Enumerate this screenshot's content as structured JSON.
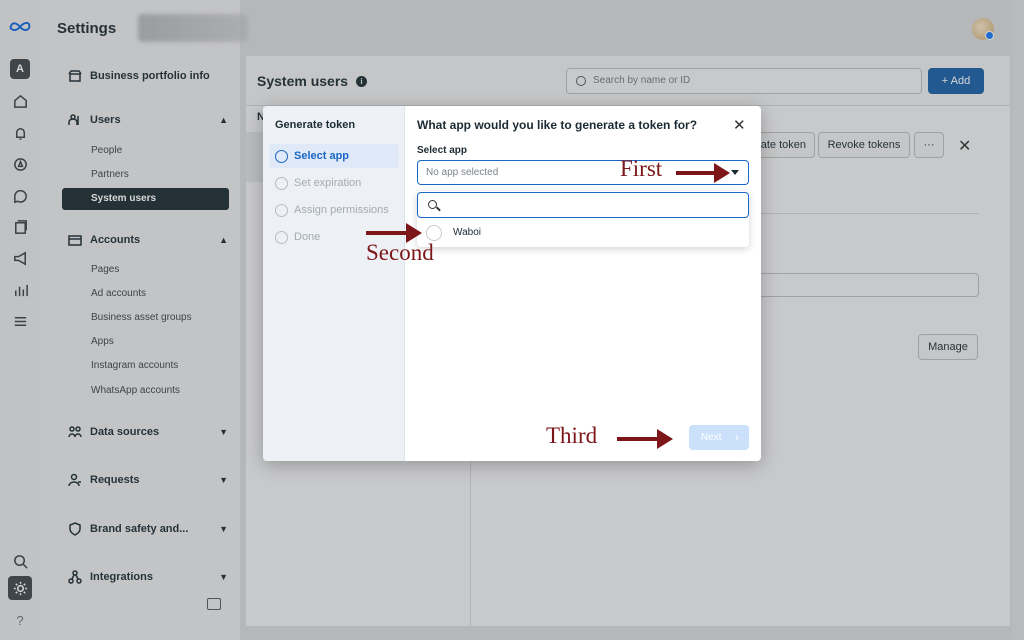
{
  "settings_title": "Settings",
  "sidebar": {
    "sections": [
      {
        "label": "Business portfolio info",
        "icon": "store-icon"
      },
      {
        "label": "Users",
        "icon": "users-icon",
        "expanded": true,
        "items": [
          "People",
          "Partners",
          "System users"
        ]
      },
      {
        "label": "Accounts",
        "icon": "folder-icon",
        "expanded": true,
        "items": [
          "Pages",
          "Ad accounts",
          "Business asset groups",
          "Apps",
          "Instagram accounts",
          "WhatsApp accounts"
        ]
      },
      {
        "label": "Data sources",
        "icon": "data-sources-icon"
      },
      {
        "label": "Requests",
        "icon": "requests-icon"
      },
      {
        "label": "Brand safety and...",
        "icon": "shield-icon"
      },
      {
        "label": "Integrations",
        "icon": "integrations-icon"
      }
    ],
    "active_item": "System users"
  },
  "rail": {
    "avatar_letter": "A",
    "help": "?"
  },
  "main": {
    "title": "System users",
    "search_placeholder": "Search by name or ID",
    "add_label": "+ Add",
    "list_header": "N",
    "gen_token_label": "ate token",
    "revoke_label": "Revoke tokens",
    "more_label": "···",
    "manage_label": "Manage"
  },
  "modal": {
    "steps_title": "Generate token",
    "steps": [
      "Select app",
      "Set expiration",
      "Assign permissions",
      "Done"
    ],
    "active_step": 0,
    "question": "What app would you like to generate a token for?",
    "select_label": "Select app",
    "select_placeholder": "No app selected",
    "options": [
      "Waboi"
    ],
    "next_label": "Next"
  },
  "annotations": {
    "first": "First",
    "second": "Second",
    "third": "Third"
  },
  "colors": {
    "accent": "#1b67c5",
    "annotation": "#7d1618",
    "add_button": "#1a5ea6"
  }
}
